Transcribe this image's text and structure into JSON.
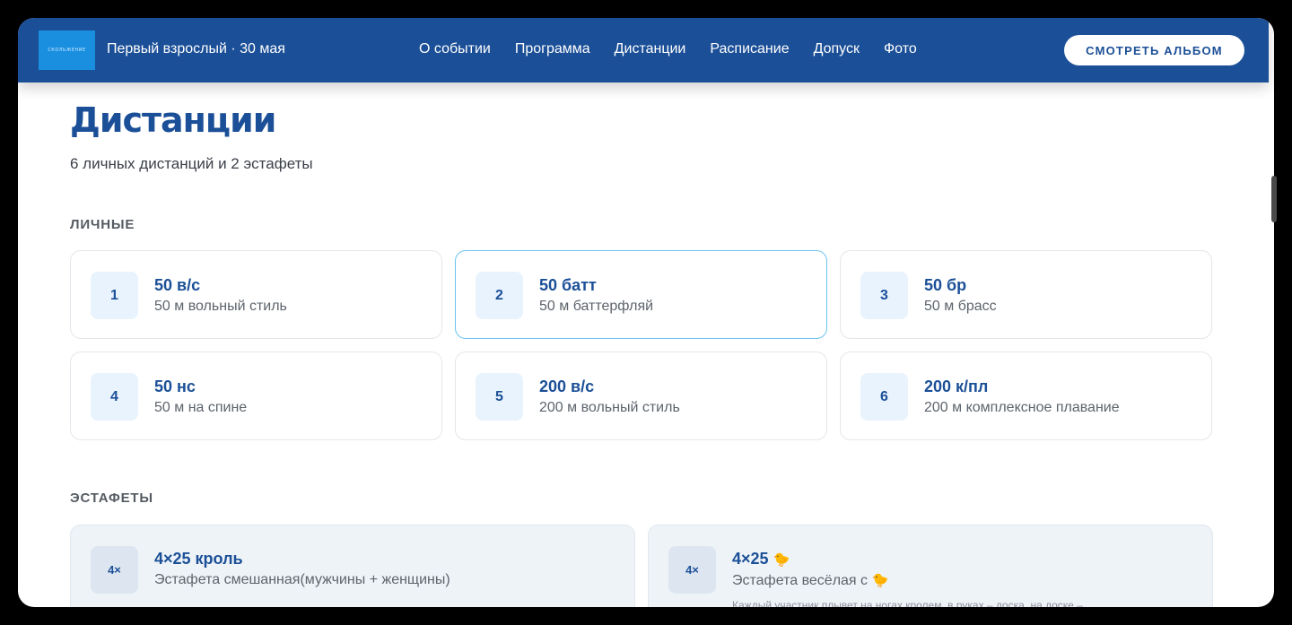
{
  "header": {
    "logo_text": "СКОЛЬЖЕНИЕ",
    "event_title": "Первый взрослый · 30 мая",
    "nav": [
      "О событии",
      "Программа",
      "Дистанции",
      "Расписание",
      "Допуск",
      "Фото"
    ],
    "album_button": "СМОТРЕТЬ АЛЬБОМ"
  },
  "page": {
    "title": "Дистанции",
    "subtitle": "6 личных дистанций и 2 эстафеты"
  },
  "personal": {
    "heading": "ЛИЧНЫЕ",
    "items": [
      {
        "num": "1",
        "name": "50 в/с",
        "desc": "50 м вольный стиль"
      },
      {
        "num": "2",
        "name": "50 батт",
        "desc": "50 м баттерфляй"
      },
      {
        "num": "3",
        "name": "50 бр",
        "desc": "50 м брасс"
      },
      {
        "num": "4",
        "name": "50 нс",
        "desc": "50 м на спине"
      },
      {
        "num": "5",
        "name": "200 в/с",
        "desc": "200 м вольный стиль"
      },
      {
        "num": "6",
        "name": "200 к/пл",
        "desc": "200 м комплексное плавание"
      }
    ]
  },
  "relays": {
    "heading": "ЭСТАФЕТЫ",
    "items": [
      {
        "badge": "4×",
        "name": "4×25 кроль",
        "desc": "Эстафета смешанная(мужчины + женщины)"
      },
      {
        "badge": "4×",
        "name": "4×25",
        "desc": "Эстафета весёлая с",
        "note": "Каждый участник плывет на ногах кролем, в руках – доска, на доске –"
      }
    ]
  },
  "icons": {
    "chick": "🐤"
  },
  "colors": {
    "brand": "#1b4f97",
    "logo_bg": "#1a8fe0",
    "active_border": "#6cc3ee"
  }
}
